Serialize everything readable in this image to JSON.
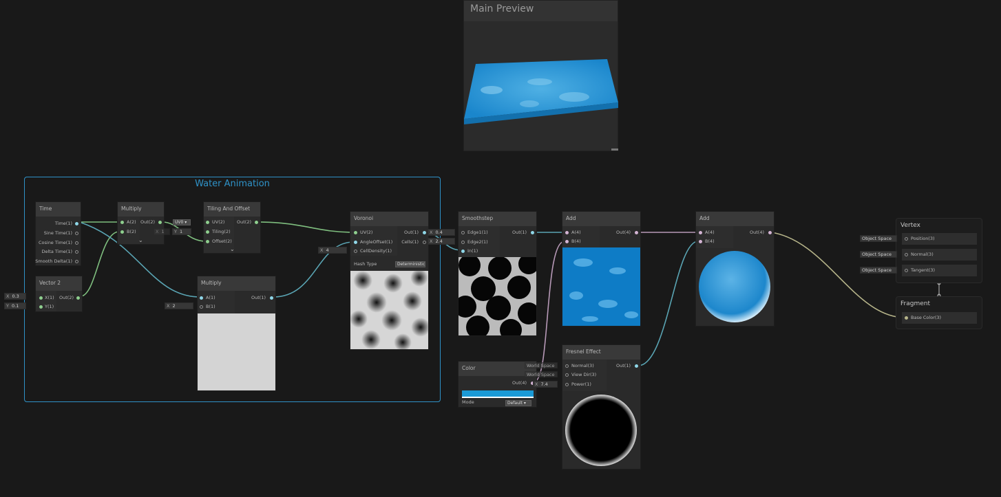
{
  "preview": {
    "title": "Main Preview"
  },
  "group": {
    "title": "Water Animation"
  },
  "nodes": {
    "time": {
      "title": "Time",
      "outputs": [
        "Time(1)",
        "Sine Time(1)",
        "Cosine Time(1)",
        "Delta Time(1)",
        "Smooth Delta(1)"
      ]
    },
    "vector2": {
      "title": "Vector 2",
      "inputs": [
        "X(1)",
        "Y(1)"
      ],
      "output": "Out(2)",
      "x_label": "X",
      "x_value": "0.3",
      "y_label": "Y",
      "y_value": "0.1"
    },
    "multiply1": {
      "title": "Multiply",
      "inputs": [
        "A(2)",
        "B(2)"
      ],
      "output": "Out(2)"
    },
    "tiling": {
      "title": "Tiling And Offset",
      "inputs": [
        "UV(2)",
        "Tiling(2)",
        "Offset(2)"
      ],
      "output": "Out(2)",
      "uv_dropdown": "UV0",
      "tiling_x_label": "X",
      "tiling_x": "1",
      "tiling_y_label": "Y",
      "tiling_y": "1"
    },
    "multiply2": {
      "title": "Multiply",
      "inputs": [
        "A(1)",
        "B(1)"
      ],
      "output": "Out(1)",
      "b_label": "X",
      "b_value": "2"
    },
    "voronoi": {
      "title": "Voronoi",
      "inputs": [
        "UV(2)",
        "AngleOffset(1)",
        "CellDensity(1)"
      ],
      "outputs": [
        "Out(1)",
        "Cells(1)"
      ],
      "hash_label": "Hash Type",
      "hash_value": "Deterministic",
      "density_label": "X",
      "density_value": "4"
    },
    "smoothstep": {
      "title": "Smoothstep",
      "inputs": [
        "Edge1(1)",
        "Edge2(1)",
        "In(1)"
      ],
      "output": "Out(1)",
      "edge1_label": "X",
      "edge1_value": "0.4",
      "edge2_label": "X",
      "edge2_value": "2.4"
    },
    "add1": {
      "title": "Add",
      "inputs": [
        "A(4)",
        "B(4)"
      ],
      "output": "Out(4)"
    },
    "add2": {
      "title": "Add",
      "inputs": [
        "A(4)",
        "B(4)"
      ],
      "output": "Out(4)"
    },
    "color": {
      "title": "Color",
      "output": "Out(4)",
      "mode_label": "Mode",
      "mode_value": "Default",
      "swatch": "#1b9ad6"
    },
    "fresnel": {
      "title": "Fresnel Effect",
      "inputs": [
        "Normal(3)",
        "View Dir(3)",
        "Power(1)"
      ],
      "output": "Out(1)",
      "normal_space": "World Space",
      "view_space": "World Space",
      "power_label": "X",
      "power_value": "7.4"
    },
    "vertex": {
      "title": "Vertex",
      "ports": [
        "Position(3)",
        "Normal(3)",
        "Tangent(3)"
      ],
      "spaces": [
        "Object Space",
        "Object Space",
        "Object Space"
      ]
    },
    "fragment": {
      "title": "Fragment",
      "ports": [
        "Base Color(3)"
      ]
    }
  },
  "colors": {
    "group_border": "#2f93c9",
    "water_blue": "#1b8fd2",
    "edge_green": "#7fbf7f",
    "edge_cyan": "#5aa5b4",
    "edge_pink": "#b89ab8"
  },
  "icons": {
    "collapse": "chevron-down-icon",
    "dropdown": "dropdown-arrow-icon"
  }
}
